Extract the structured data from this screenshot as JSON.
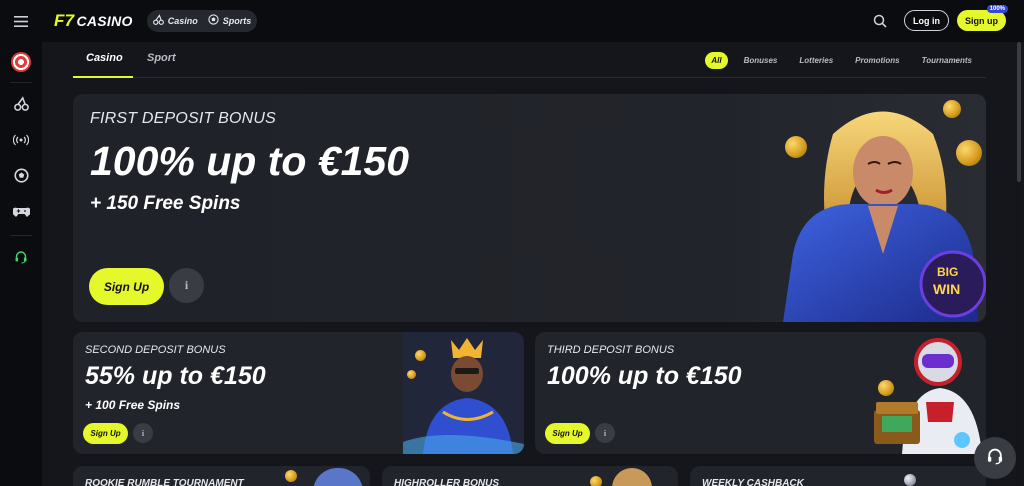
{
  "header": {
    "logo_mark": "F7",
    "logo_text": "CASINO",
    "mode_switch": [
      {
        "label": "Casino",
        "icon": "cherries-icon"
      },
      {
        "label": "Sports",
        "icon": "soccer-ball-icon"
      }
    ],
    "login_label": "Log in",
    "signup_label": "Sign up",
    "signup_badge": "100%"
  },
  "sidebar": {
    "items": [
      {
        "icon": "target-icon"
      },
      {
        "icon": "cherries-icon"
      },
      {
        "icon": "live-broadcast-icon"
      },
      {
        "icon": "soccer-ball-icon"
      },
      {
        "icon": "gamepad-icon"
      },
      {
        "icon": "headset-icon"
      }
    ]
  },
  "tabs": [
    {
      "label": "Casino",
      "active": true
    },
    {
      "label": "Sport",
      "active": false
    }
  ],
  "filters": [
    {
      "label": "All",
      "active": true
    },
    {
      "label": "Bonuses",
      "active": false
    },
    {
      "label": "Lotteries",
      "active": false
    },
    {
      "label": "Promotions",
      "active": false
    },
    {
      "label": "Tournaments",
      "active": false
    }
  ],
  "hero": {
    "label": "FIRST DEPOSIT BONUS",
    "amount": "100% up to €150",
    "sub": "+ 150 Free Spins",
    "cta": "Sign Up",
    "info": "i",
    "art_text": "BIG WIN"
  },
  "cards": [
    {
      "label": "SECOND DEPOSIT BONUS",
      "amount": "55% up to €150",
      "sub": "+ 100 Free Spins",
      "cta": "Sign Up",
      "info": "i"
    },
    {
      "label": "THIRD DEPOSIT BONUS",
      "amount": "100% up to €150",
      "sub": "",
      "cta": "Sign Up",
      "info": "i"
    }
  ],
  "bottom_cards": [
    {
      "label": "ROOKIE RUMBLE TOURNAMENT"
    },
    {
      "label": "HIGHROLLER BONUS"
    },
    {
      "label": "WEEKLY CASHBACK"
    }
  ],
  "colors": {
    "accent": "#e5f82b",
    "background": "#15161b",
    "card": "#22242b"
  }
}
